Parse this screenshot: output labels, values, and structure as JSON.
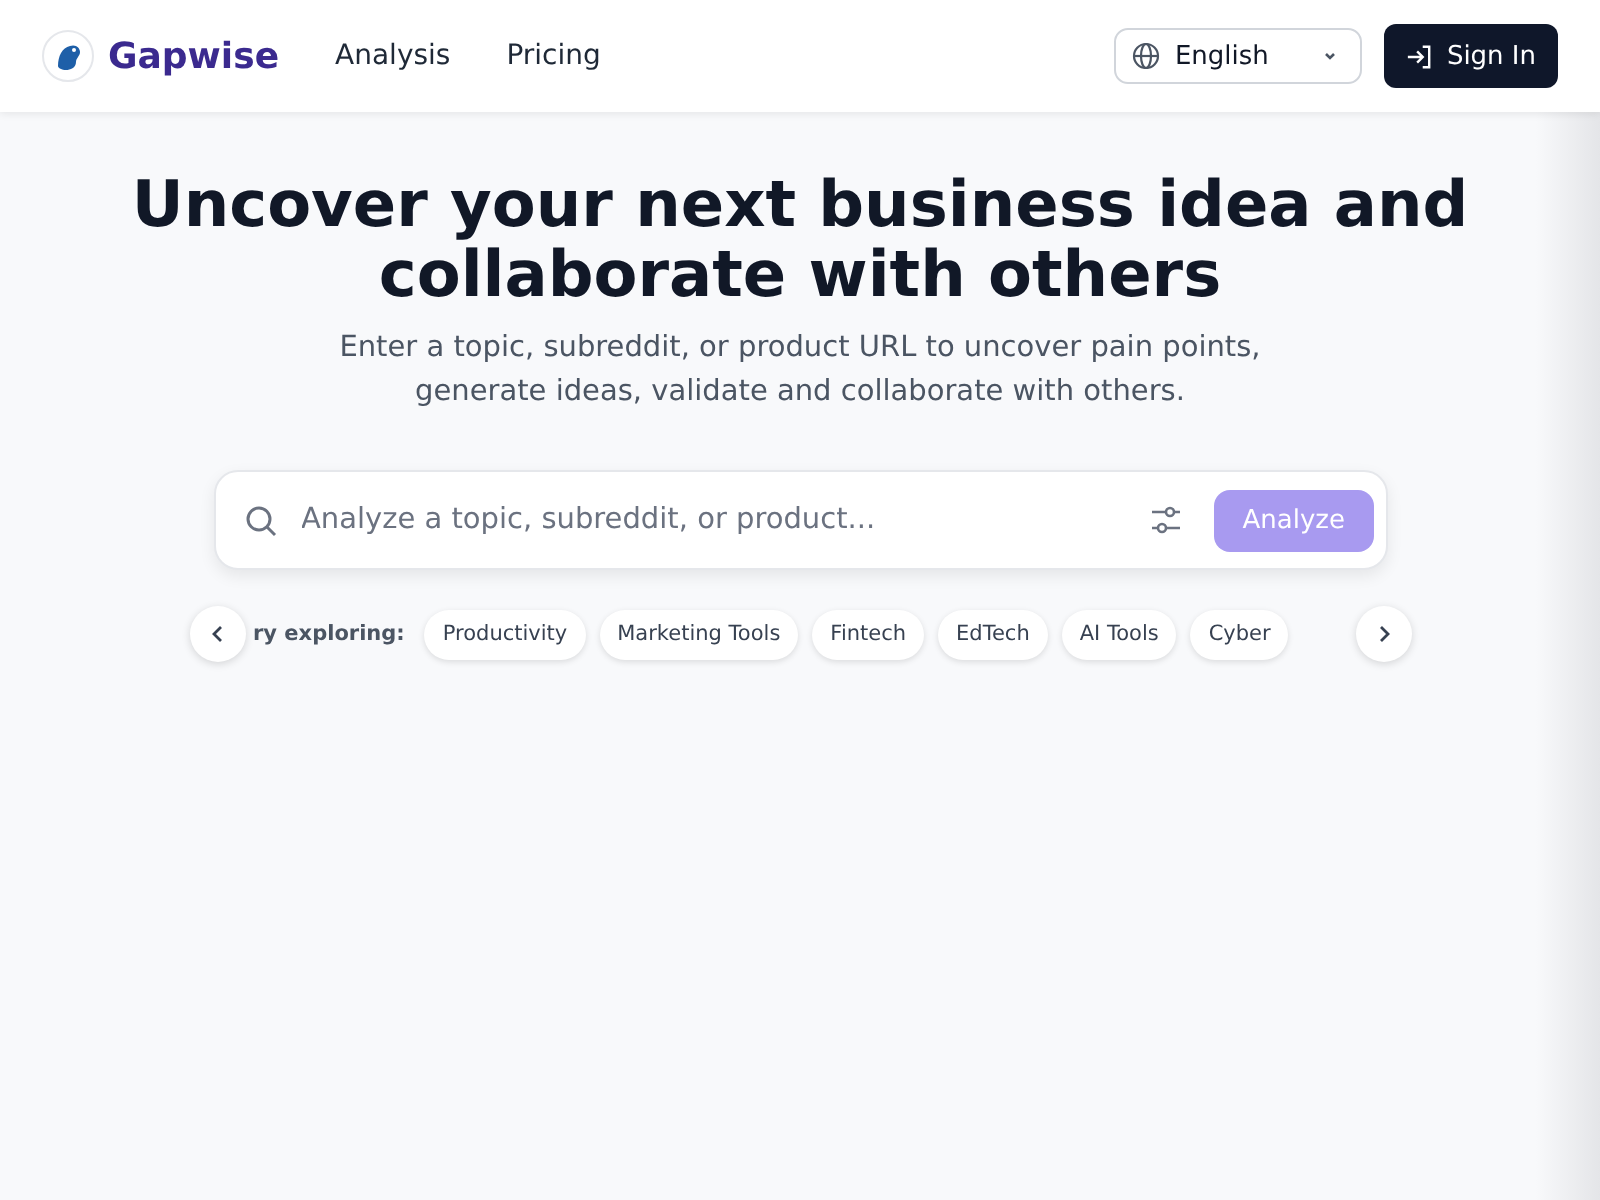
{
  "nav": {
    "brand": "Gapwise",
    "links": [
      "Analysis",
      "Pricing"
    ],
    "language": "English",
    "sign_in": "Sign In"
  },
  "hero": {
    "title_lines": [
      "Uncover your next business idea and",
      "collaborate with others"
    ],
    "subtitle_lines": [
      "Enter a topic, subreddit, or product URL to uncover pain points,",
      "generate ideas, validate and collaborate with others."
    ]
  },
  "search": {
    "placeholder": "Analyze a topic, subreddit, or product...",
    "button": "Analyze"
  },
  "explore": {
    "label": "ry exploring:",
    "chips": [
      "Productivity",
      "Marketing Tools",
      "Fintech",
      "EdTech",
      "AI Tools",
      "Cyber"
    ]
  }
}
